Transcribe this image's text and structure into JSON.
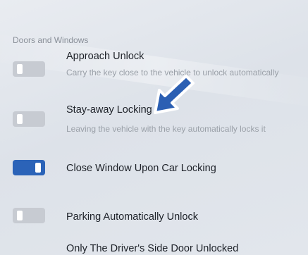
{
  "section": {
    "title": "Doors and Windows"
  },
  "settings": [
    {
      "label": "Approach Unlock",
      "description": "Carry the key close to the vehicle to unlock automatically",
      "enabled": false
    },
    {
      "label": "Stay-away Locking",
      "description": "Leaving the vehicle with the key automatically locks it",
      "enabled": false
    },
    {
      "label": "Close Window Upon Car Locking",
      "description": "",
      "enabled": true
    },
    {
      "label": "Parking Automatically Unlock",
      "description": "",
      "enabled": false
    },
    {
      "label": "Only The Driver's Side Door Unlocked",
      "description": "",
      "enabled": null
    }
  ],
  "colors": {
    "toggle_on": "#2b63b8",
    "toggle_off": "#c7cbd2",
    "arrow_fill": "#2b5fb3"
  },
  "icons": {
    "pointer": "arrow-pointer-icon"
  }
}
